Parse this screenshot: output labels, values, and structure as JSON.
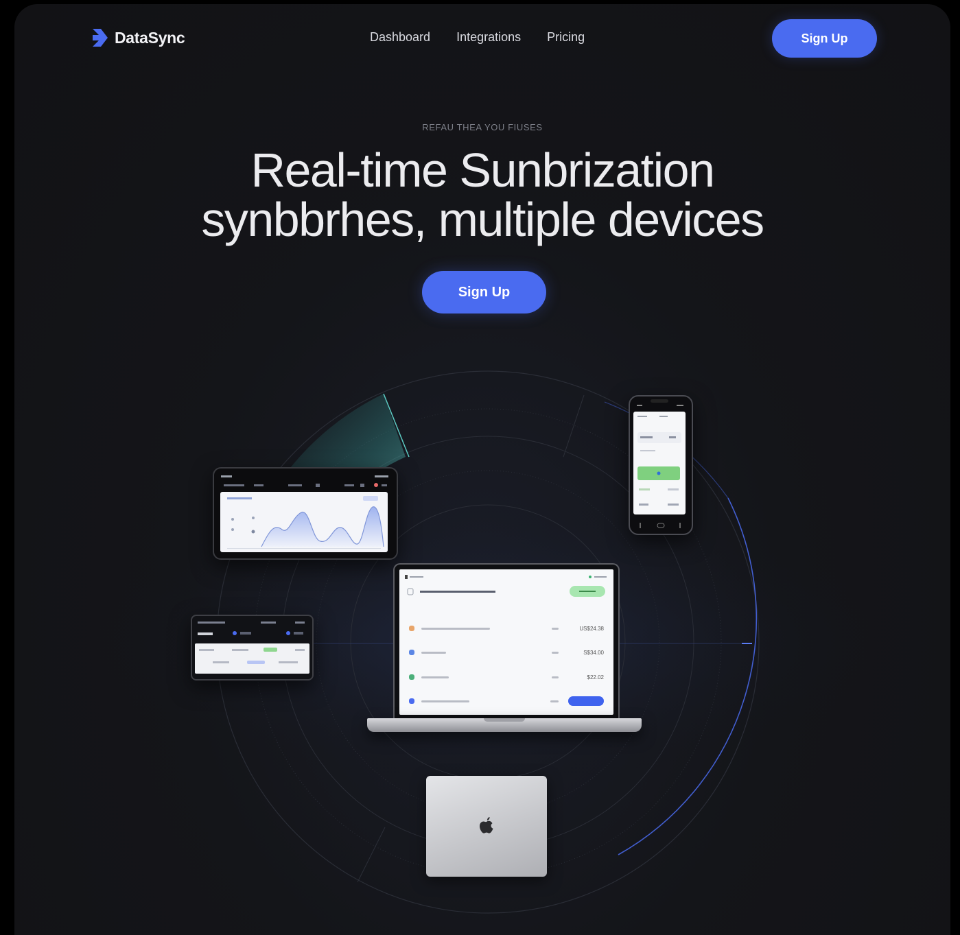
{
  "brand": {
    "name": "DataSync",
    "accent": "#4a6bf0"
  },
  "nav": {
    "items": [
      {
        "label": "Dashboard"
      },
      {
        "label": "Integrations"
      },
      {
        "label": "Pricing"
      }
    ]
  },
  "header": {
    "signup_label": "Sign Up"
  },
  "hero": {
    "eyebrow": "REFAU THEA YOU FIUSES",
    "headline_line1": "Real-time Sunbrization",
    "headline_line2": "synbbrhes, multiple devices",
    "cta_label": "Sign Up"
  },
  "laptop_rows": [
    {
      "icon_color": "#e8a56a",
      "amount": "US$24.38"
    },
    {
      "icon_color": "#5b86e5",
      "amount": "S$34.00"
    },
    {
      "icon_color": "#4caf7a",
      "amount": "$22.02"
    },
    {
      "icon_color": "#4a6bf0",
      "amount": ""
    }
  ],
  "icons": {
    "logo": "arrow-logo-icon",
    "apple": "apple-logo-icon"
  }
}
